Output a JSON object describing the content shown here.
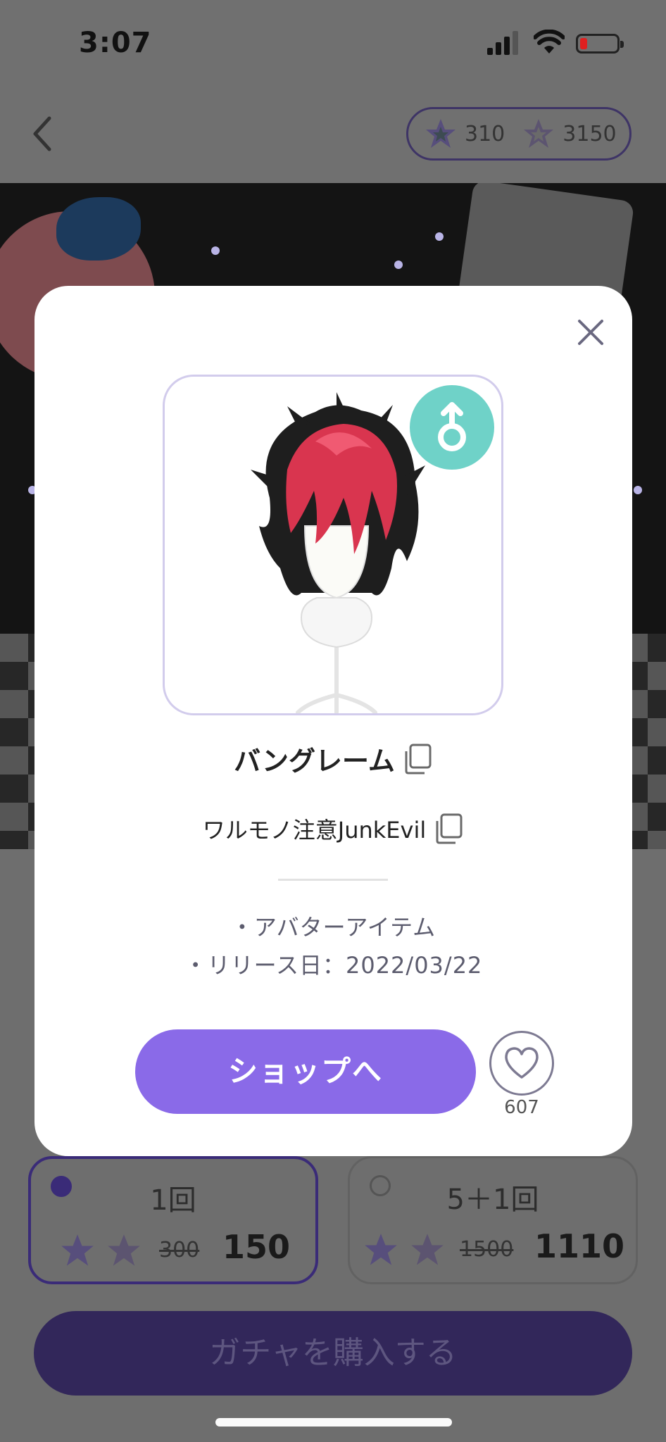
{
  "status_bar": {
    "time": "3:07"
  },
  "header": {
    "currency_1": "310",
    "currency_2": "3150"
  },
  "modal": {
    "item_name": "バングレーム",
    "series_name": "ワルモノ注意JunkEvil",
    "meta_type": "・アバターアイテム",
    "meta_release": "・リリース日：2022/03/22",
    "shop_button": "ショップへ",
    "like_count": "607",
    "gender_symbol": "male-symbol",
    "accent_color": "#8a6ae8",
    "badge_color": "#6fd2c8"
  },
  "gacha": {
    "options": [
      {
        "title": "1回",
        "old_price": "300",
        "price": "150",
        "selected": true
      },
      {
        "title": "5＋1回",
        "old_price": "1500",
        "price": "1110",
        "selected": false
      }
    ],
    "buy_button": "ガチャを購入する"
  }
}
